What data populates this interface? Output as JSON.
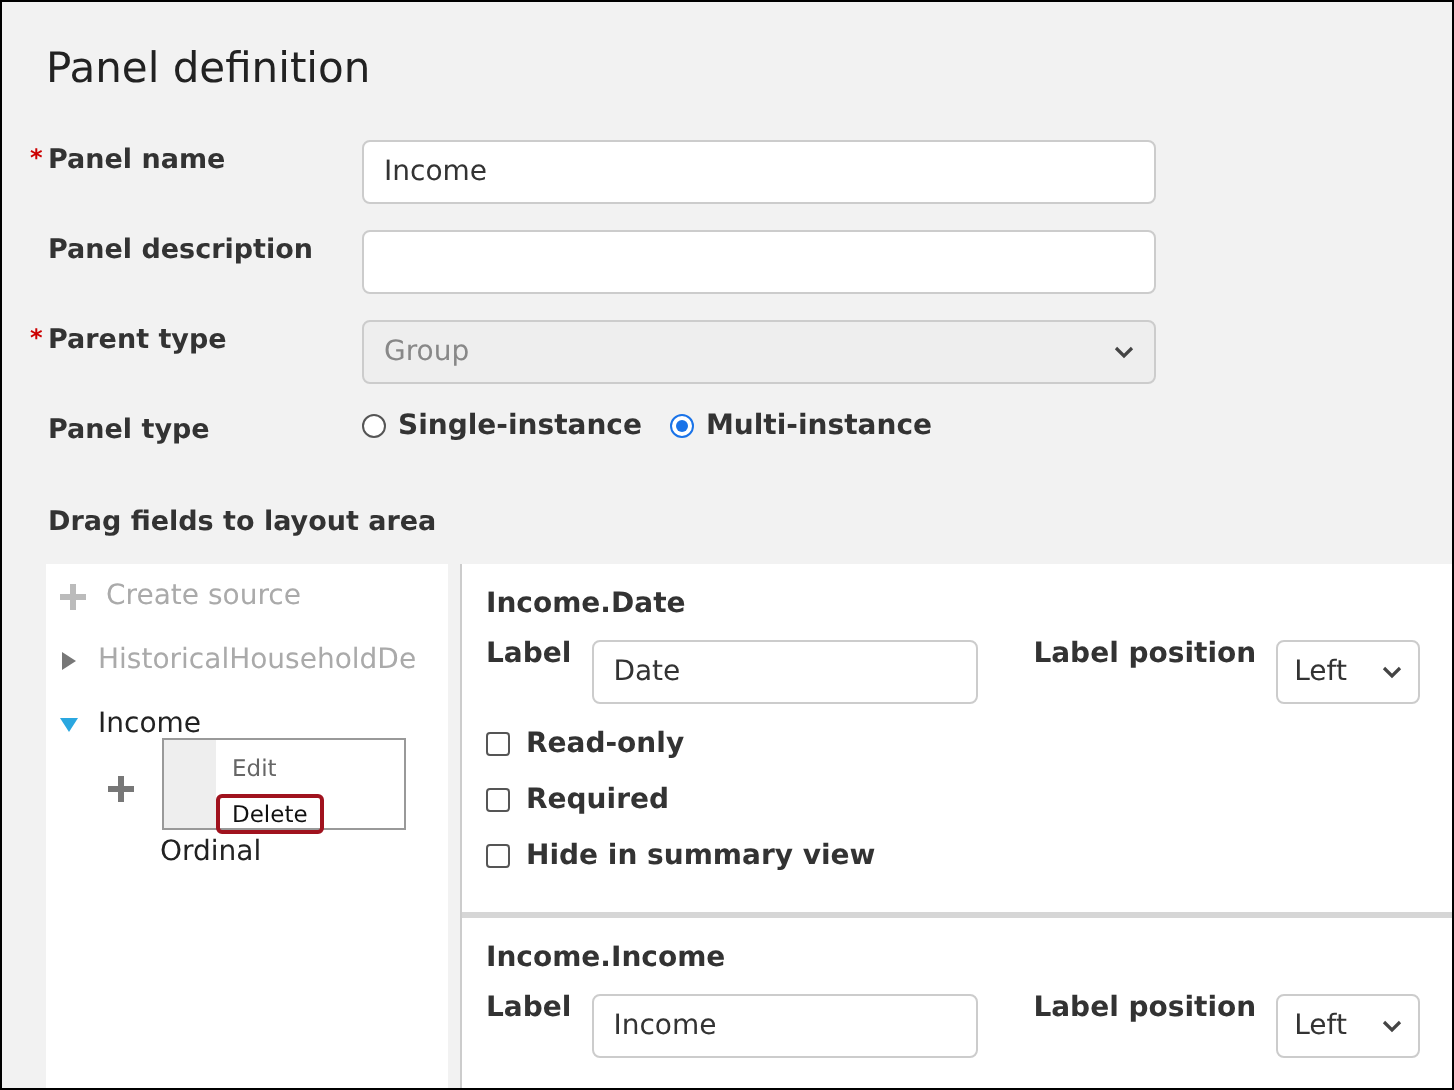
{
  "title": "Panel definition",
  "required_marker": "*",
  "form": [
    {
      "label": "Panel name",
      "required": true,
      "kind": "text",
      "value": "Income"
    },
    {
      "label": "Panel description",
      "required": false,
      "kind": "text"
    },
    {
      "label": "Parent type",
      "required": true,
      "kind": "select",
      "value": "Group",
      "disabled": true
    }
  ],
  "panel_type": {
    "label": "Panel type",
    "options": [
      {
        "label": "Single-instance",
        "selected": false
      },
      {
        "label": "Multi-instance",
        "selected": true
      }
    ]
  },
  "drag_heading": "Drag fields to layout area",
  "tree": {
    "create_source": {
      "label": "Create source",
      "disabled": true
    },
    "items": [
      {
        "label": "HistoricalHouseholdDe",
        "expanded": false,
        "disabled": true
      },
      {
        "label": "Income",
        "expanded": true,
        "disabled": false,
        "children": [
          {
            "kind": "add"
          },
          {
            "kind": "field",
            "label": "Ordinal"
          }
        ]
      }
    ]
  },
  "context_menu": [
    {
      "label": "Edit",
      "selected": false
    },
    {
      "label": "Delete",
      "selected": true
    }
  ],
  "fields": [
    {
      "name": "Income.Date",
      "label_caption": "Label",
      "label": "Date",
      "position_caption": "Label position",
      "position": "Left",
      "options": [
        {
          "label": "Read-only",
          "checked": false
        },
        {
          "label": "Required",
          "checked": false
        },
        {
          "label": "Hide in summary view",
          "checked": false
        }
      ]
    },
    {
      "name": "Income.Income",
      "label_caption": "Label",
      "label": "Income",
      "position_caption": "Label position",
      "position": "Left"
    }
  ]
}
